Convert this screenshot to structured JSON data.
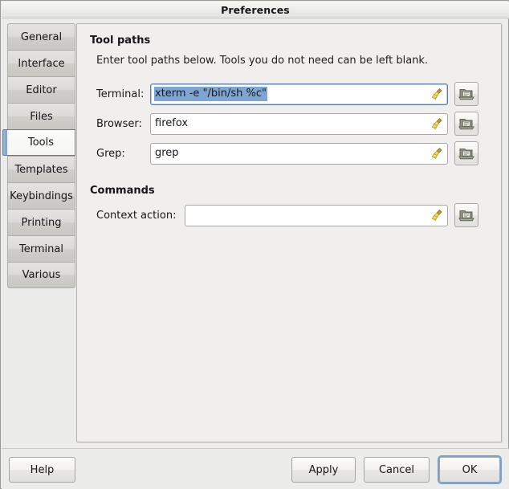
{
  "window": {
    "title": "Preferences"
  },
  "sidebar": {
    "items": [
      {
        "label": "General",
        "selected": false
      },
      {
        "label": "Interface",
        "selected": false
      },
      {
        "label": "Editor",
        "selected": false
      },
      {
        "label": "Files",
        "selected": false
      },
      {
        "label": "Tools",
        "selected": true
      },
      {
        "label": "Templates",
        "selected": false
      },
      {
        "label": "Keybindings",
        "selected": false
      },
      {
        "label": "Printing",
        "selected": false
      },
      {
        "label": "Terminal",
        "selected": false
      },
      {
        "label": "Various",
        "selected": false
      }
    ]
  },
  "content": {
    "tool_paths": {
      "heading": "Tool paths",
      "description": "Enter tool paths below. Tools you do not need can be left blank.",
      "fields": [
        {
          "label": "Terminal:",
          "value": "xterm -e \"/bin/sh %c\"",
          "placeholder": "",
          "focused": true,
          "text_selected": true,
          "clear_icon": "broom-icon",
          "browse_icon": "folder-open-icon"
        },
        {
          "label": "Browser:",
          "value": "firefox",
          "placeholder": "",
          "focused": false,
          "text_selected": false,
          "clear_icon": "broom-icon",
          "browse_icon": "folder-open-icon"
        },
        {
          "label": "Grep:",
          "value": "grep",
          "placeholder": "",
          "focused": false,
          "text_selected": false,
          "clear_icon": "broom-icon",
          "browse_icon": "folder-open-icon"
        }
      ]
    },
    "commands": {
      "heading": "Commands",
      "fields": [
        {
          "label": "Context action:",
          "value": "",
          "placeholder": "",
          "focused": false,
          "text_selected": false,
          "clear_icon": "broom-icon",
          "browse_icon": "folder-open-icon"
        }
      ]
    }
  },
  "footer": {
    "help_label": "Help",
    "apply_label": "Apply",
    "cancel_label": "Cancel",
    "ok_label": "OK"
  },
  "colors": {
    "accent": "#5b7fab",
    "selection": "#7fa6d2",
    "window_bg": "#ececea",
    "panel_bg": "#f0efed",
    "entry_bg": "#ffffff"
  }
}
